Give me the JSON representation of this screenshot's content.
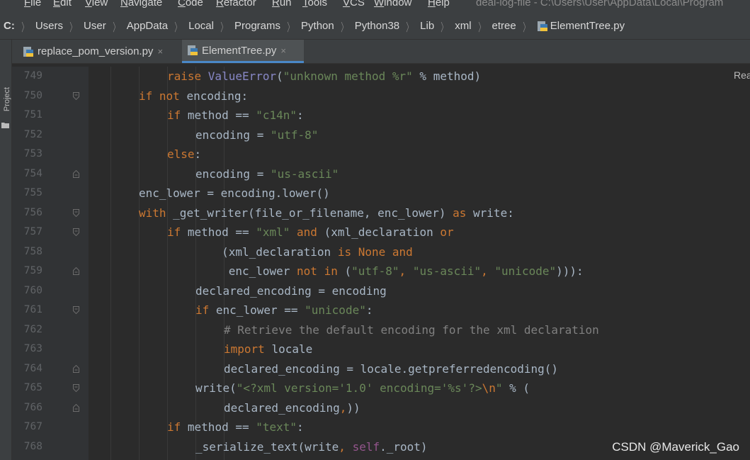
{
  "menu": {
    "items": [
      "File",
      "Edit",
      "View",
      "Navigate",
      "Code",
      "Refactor",
      "Run",
      "Tools",
      "VCS",
      "Window",
      "Help"
    ],
    "window_title": "deal-log-file - C:\\Users\\User\\AppData\\Local\\Program"
  },
  "breadcrumbs": [
    "C:",
    "Users",
    "User",
    "AppData",
    "Local",
    "Programs",
    "Python",
    "Python38",
    "Lib",
    "xml",
    "etree",
    "ElementTree.py"
  ],
  "sidebar": {
    "project_label": "Project"
  },
  "tabs": [
    {
      "label": "replace_pom_version.py",
      "close": "×",
      "active": false
    },
    {
      "label": "ElementTree.py",
      "close": "×",
      "active": true
    }
  ],
  "reader_mode_hint": "Rea",
  "watermark": "CSDN @Maverick_Gao",
  "code_lines": [
    {
      "num": "749",
      "indent": 3,
      "fold": "",
      "tokens": [
        [
          "kw",
          "raise "
        ],
        [
          "bi",
          "ValueError"
        ],
        [
          "",
          "("
        ],
        [
          "str",
          "\"unknown method %r\""
        ],
        [
          "",
          " % method)"
        ]
      ]
    },
    {
      "num": "750",
      "indent": 2,
      "fold": "open",
      "tokens": [
        [
          "kw",
          "if not "
        ],
        [
          "",
          "encoding:"
        ]
      ]
    },
    {
      "num": "751",
      "indent": 3,
      "fold": "",
      "tokens": [
        [
          "kw",
          "if "
        ],
        [
          "",
          "method == "
        ],
        [
          "str",
          "\"c14n\""
        ],
        [
          "",
          ":"
        ]
      ]
    },
    {
      "num": "752",
      "indent": 4,
      "fold": "",
      "tokens": [
        [
          "",
          "encoding = "
        ],
        [
          "str",
          "\"utf-8\""
        ]
      ]
    },
    {
      "num": "753",
      "indent": 3,
      "fold": "",
      "tokens": [
        [
          "kw",
          "else"
        ],
        [
          "",
          ":"
        ]
      ]
    },
    {
      "num": "754",
      "indent": 4,
      "fold": "close",
      "tokens": [
        [
          "",
          "encoding = "
        ],
        [
          "str",
          "\"us-ascii\""
        ]
      ]
    },
    {
      "num": "755",
      "indent": 2,
      "fold": "",
      "tokens": [
        [
          "",
          "enc_lower = encoding.lower()"
        ]
      ]
    },
    {
      "num": "756",
      "indent": 2,
      "fold": "open",
      "tokens": [
        [
          "kw",
          "with "
        ],
        [
          "",
          "_get_writer(file_or_filename, enc_lower) "
        ],
        [
          "kw",
          "as "
        ],
        [
          "",
          "write:"
        ]
      ]
    },
    {
      "num": "757",
      "indent": 3,
      "fold": "open",
      "tokens": [
        [
          "kw",
          "if "
        ],
        [
          "",
          "method == "
        ],
        [
          "str",
          "\"xml\""
        ],
        [
          "kw",
          " and "
        ],
        [
          "",
          "(xml_declaration "
        ],
        [
          "kw",
          "or"
        ]
      ]
    },
    {
      "num": "758",
      "indent": 3,
      "fold": "",
      "tokens": [
        [
          "",
          "        (xml_declaration "
        ],
        [
          "kw",
          "is None and"
        ]
      ]
    },
    {
      "num": "759",
      "indent": 3,
      "fold": "close",
      "tokens": [
        [
          "",
          "         enc_lower "
        ],
        [
          "kw",
          "not in "
        ],
        [
          "",
          "("
        ],
        [
          "str",
          "\"utf-8\""
        ],
        [
          "kw",
          ", "
        ],
        [
          "str",
          "\"us-ascii\""
        ],
        [
          "kw",
          ", "
        ],
        [
          "str",
          "\"unicode\""
        ],
        [
          "",
          ")))"
        ],
        [
          "",
          ":"
        ]
      ]
    },
    {
      "num": "760",
      "indent": 4,
      "fold": "",
      "tokens": [
        [
          "",
          "declared_encoding = encoding"
        ]
      ]
    },
    {
      "num": "761",
      "indent": 4,
      "fold": "open",
      "tokens": [
        [
          "kw",
          "if "
        ],
        [
          "",
          "enc_lower == "
        ],
        [
          "str",
          "\"unicode\""
        ],
        [
          "",
          ":"
        ]
      ]
    },
    {
      "num": "762",
      "indent": 5,
      "fold": "",
      "tokens": [
        [
          "cm",
          "# Retrieve the default encoding for the xml declaration"
        ]
      ]
    },
    {
      "num": "763",
      "indent": 5,
      "fold": "",
      "tokens": [
        [
          "kw",
          "import "
        ],
        [
          "",
          "locale"
        ]
      ]
    },
    {
      "num": "764",
      "indent": 5,
      "fold": "close",
      "tokens": [
        [
          "",
          "declared_encoding = locale.getpreferredencoding()"
        ]
      ]
    },
    {
      "num": "765",
      "indent": 4,
      "fold": "open",
      "tokens": [
        [
          "",
          "write("
        ],
        [
          "str",
          "\"<?xml version='1.0' encoding='%s'?>"
        ],
        [
          "esc",
          "\\n"
        ],
        [
          "str",
          "\""
        ],
        [
          "",
          " % ("
        ]
      ]
    },
    {
      "num": "766",
      "indent": 5,
      "fold": "close",
      "tokens": [
        [
          "",
          "declared_encoding"
        ],
        [
          "kw",
          ","
        ],
        [
          "",
          "))"
        ]
      ]
    },
    {
      "num": "767",
      "indent": 3,
      "fold": "",
      "tokens": [
        [
          "kw",
          "if "
        ],
        [
          "",
          "method == "
        ],
        [
          "str",
          "\"text\""
        ],
        [
          "",
          ":"
        ]
      ]
    },
    {
      "num": "768",
      "indent": 4,
      "fold": "",
      "tokens": [
        [
          "",
          "_serialize_text(write"
        ],
        [
          "kw",
          ", "
        ],
        [
          "slf",
          "self"
        ],
        [
          "",
          "._root)"
        ]
      ]
    }
  ],
  "colors": {
    "keyword": "#cc7832",
    "string": "#6a8759",
    "comment": "#808080",
    "self": "#94558d",
    "builtin": "#8888c6",
    "default": "#a9b7c6",
    "background": "#2b2b2b",
    "line_number": "#606366"
  }
}
